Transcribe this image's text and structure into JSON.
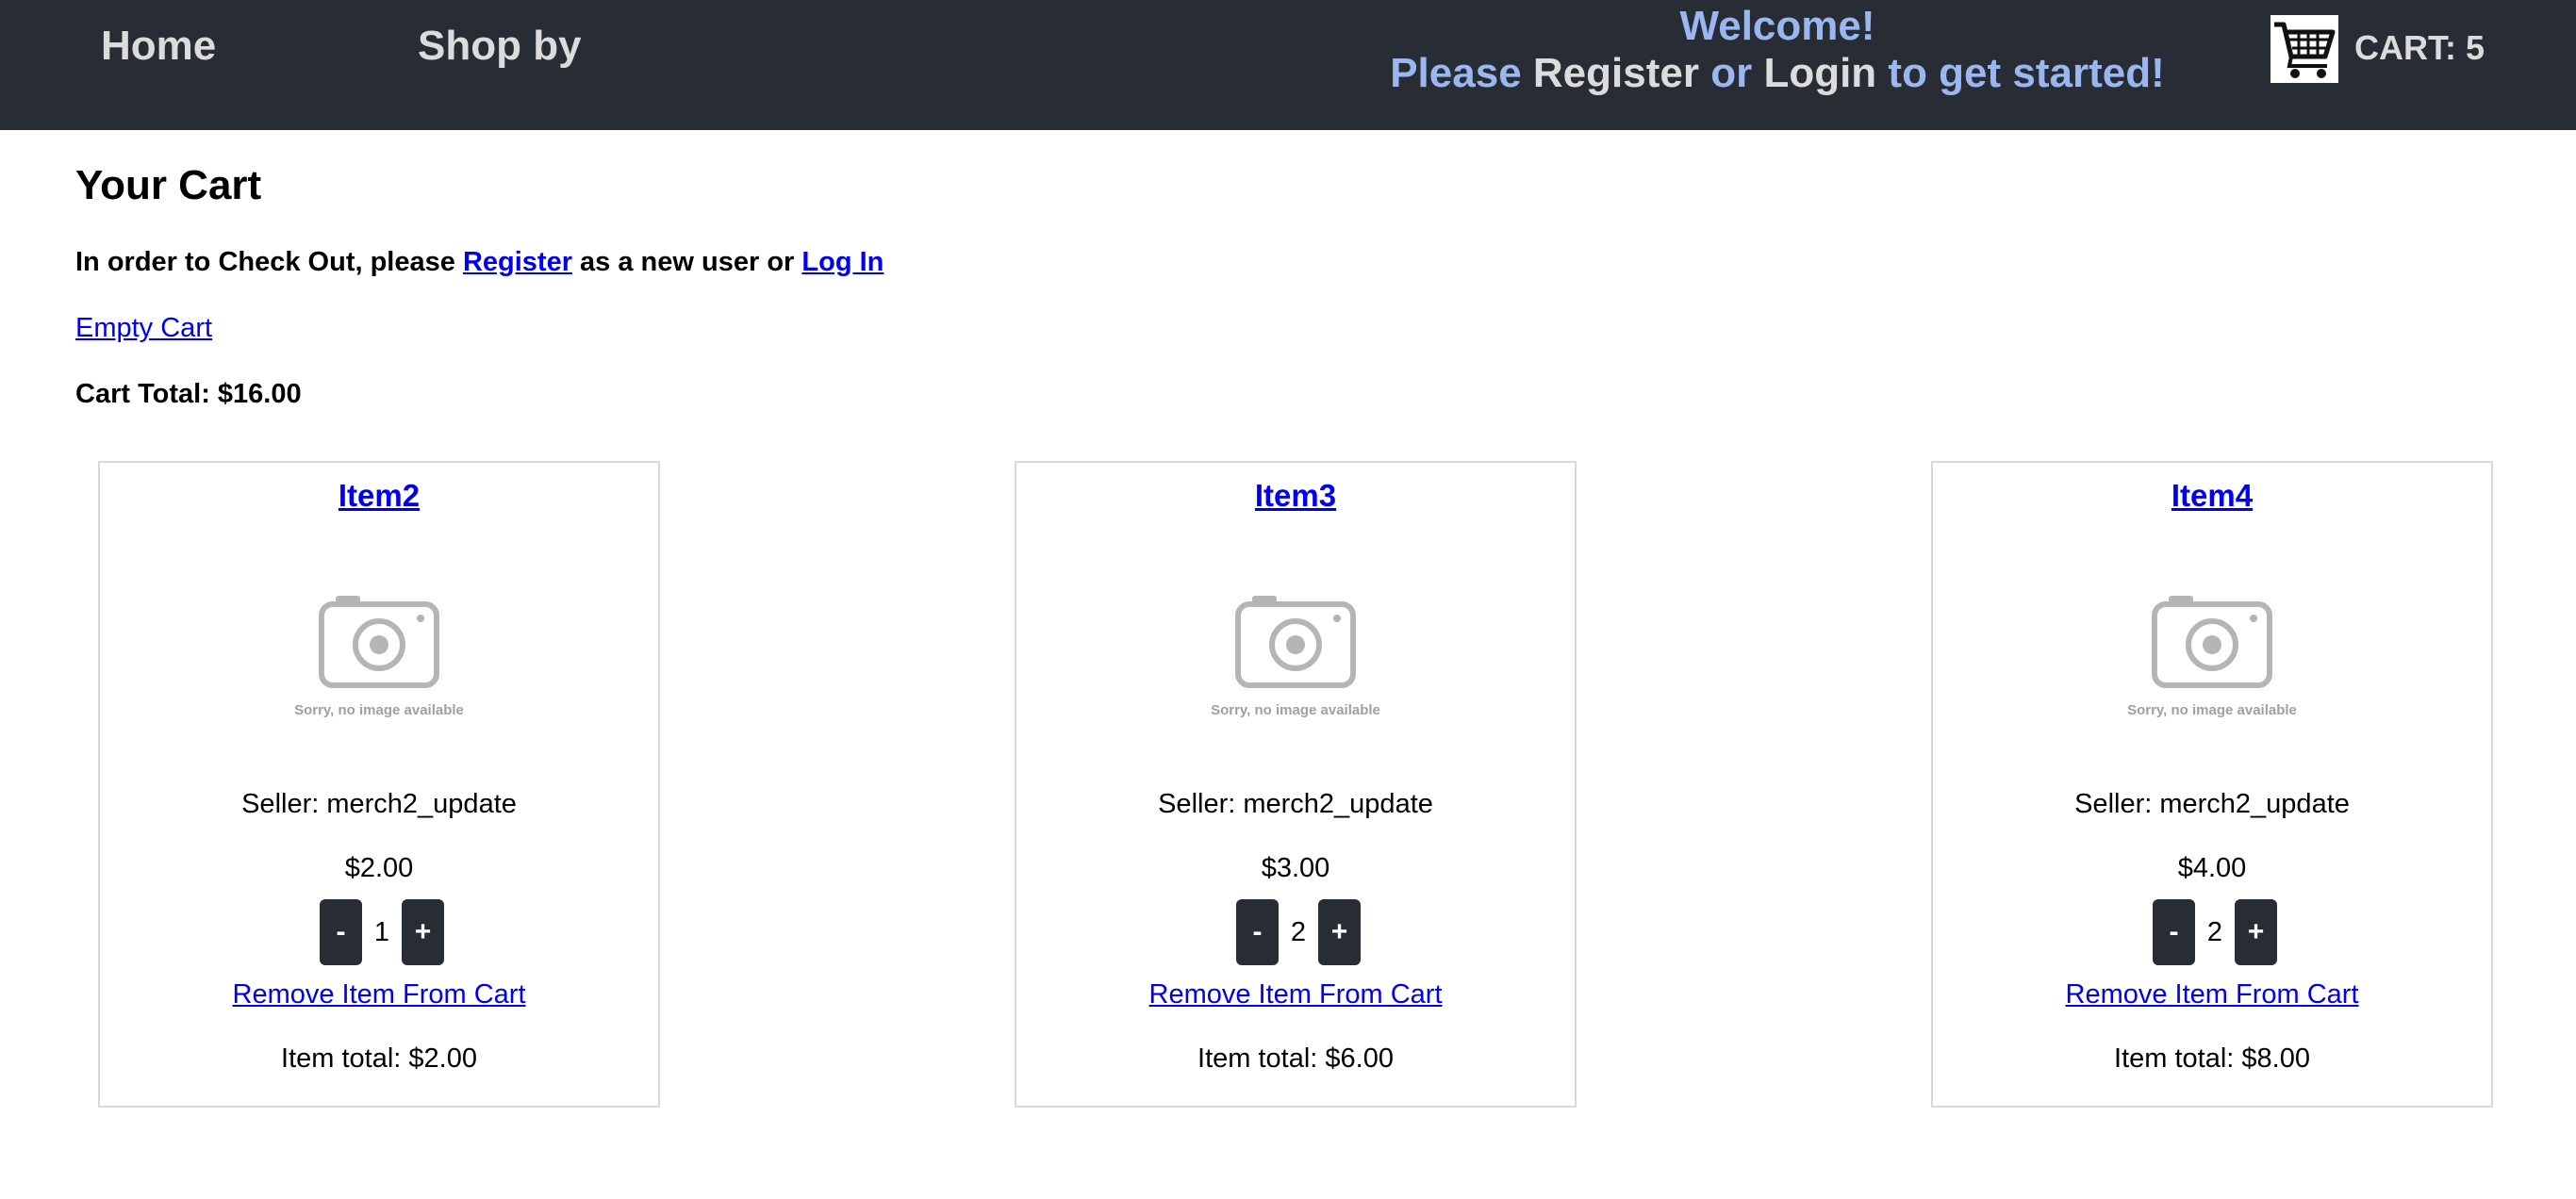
{
  "nav": {
    "home_label": "Home",
    "shop_label": "Shop by",
    "welcome_line1": "Welcome!",
    "please": "Please",
    "register": "Register",
    "or": "or",
    "login": "Login",
    "get_started": "to get started!",
    "cart_label": "CART: 5"
  },
  "page": {
    "title": "Your Cart",
    "checkout_prefix": "In order to Check Out, please",
    "checkout_register": "Register",
    "checkout_middle": "as a new user or",
    "checkout_login": "Log In",
    "empty_cart": "Empty Cart",
    "cart_total": "Cart Total: $16.00"
  },
  "image_placeholder_text": "Sorry, no image available",
  "items": [
    {
      "name": "Item2",
      "seller": "Seller: merch2_update",
      "price": "$2.00",
      "qty": "1",
      "remove": "Remove Item From Cart",
      "total": "Item total: $2.00"
    },
    {
      "name": "Item3",
      "seller": "Seller: merch2_update",
      "price": "$3.00",
      "qty": "2",
      "remove": "Remove Item From Cart",
      "total": "Item total: $6.00"
    },
    {
      "name": "Item4",
      "seller": "Seller: merch2_update",
      "price": "$4.00",
      "qty": "2",
      "remove": "Remove Item From Cart",
      "total": "Item total: $8.00"
    }
  ],
  "stepper": {
    "minus": "-",
    "plus": "+"
  },
  "colors": {
    "navbar": "#282c34",
    "nav_text": "#dcdcdc",
    "welcome_accent": "#9ab7f0",
    "link": "#0000ee"
  }
}
